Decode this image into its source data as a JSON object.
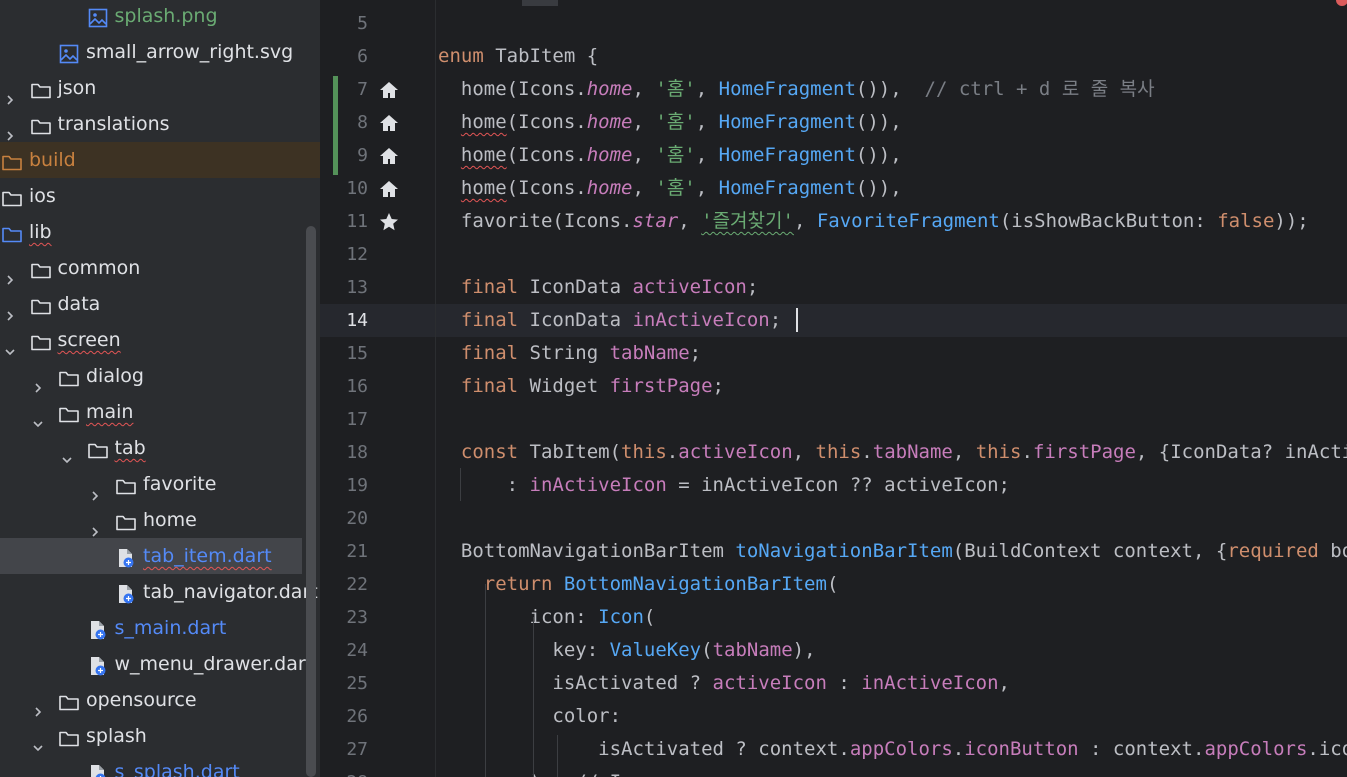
{
  "project_tree": {
    "items": [
      {
        "label": "splash.png",
        "kind": "image",
        "indent": 3,
        "expander": "none",
        "color": "green"
      },
      {
        "label": "small_arrow_right.svg",
        "kind": "image",
        "indent": 2,
        "expander": "none",
        "color": "normal"
      },
      {
        "label": "json",
        "kind": "folder",
        "indent": 1,
        "expander": "collapsed",
        "color": "normal"
      },
      {
        "label": "translations",
        "kind": "folder",
        "indent": 1,
        "expander": "collapsed",
        "color": "normal"
      },
      {
        "label": "build",
        "kind": "folder-excluded",
        "indent": 0,
        "expander": "none",
        "color": "orange"
      },
      {
        "label": "ios",
        "kind": "folder",
        "indent": 0,
        "expander": "none",
        "color": "normal"
      },
      {
        "label": "lib",
        "kind": "folder-source",
        "indent": 0,
        "expander": "none",
        "color": "normal",
        "squiggle": true
      },
      {
        "label": "common",
        "kind": "folder",
        "indent": 1,
        "expander": "collapsed",
        "color": "normal"
      },
      {
        "label": "data",
        "kind": "folder",
        "indent": 1,
        "expander": "collapsed",
        "color": "normal"
      },
      {
        "label": "screen",
        "kind": "folder",
        "indent": 1,
        "expander": "expanded",
        "color": "normal",
        "squiggle": true
      },
      {
        "label": "dialog",
        "kind": "folder",
        "indent": 2,
        "expander": "collapsed",
        "color": "normal"
      },
      {
        "label": "main",
        "kind": "folder",
        "indent": 2,
        "expander": "expanded",
        "color": "normal",
        "squiggle": true
      },
      {
        "label": "tab",
        "kind": "folder",
        "indent": 3,
        "expander": "expanded",
        "color": "normal",
        "squiggle": true
      },
      {
        "label": "favorite",
        "kind": "folder",
        "indent": 4,
        "expander": "collapsed",
        "color": "normal"
      },
      {
        "label": "home",
        "kind": "folder",
        "indent": 4,
        "expander": "collapsed",
        "color": "normal"
      },
      {
        "label": "tab_item.dart",
        "kind": "dart",
        "indent": 4,
        "expander": "none",
        "color": "blue",
        "selected": true,
        "squiggle": true
      },
      {
        "label": "tab_navigator.dart",
        "kind": "dart",
        "indent": 4,
        "expander": "none",
        "color": "normal"
      },
      {
        "label": "s_main.dart",
        "kind": "dart",
        "indent": 3,
        "expander": "none",
        "color": "blue"
      },
      {
        "label": "w_menu_drawer.dart",
        "kind": "dart",
        "indent": 3,
        "expander": "none",
        "color": "normal"
      },
      {
        "label": "opensource",
        "kind": "folder",
        "indent": 2,
        "expander": "collapsed",
        "color": "normal"
      },
      {
        "label": "splash",
        "kind": "folder",
        "indent": 2,
        "expander": "expanded",
        "color": "normal"
      },
      {
        "label": "s_splash.dart",
        "kind": "dart",
        "indent": 3,
        "expander": "none",
        "color": "blue"
      }
    ]
  },
  "editor": {
    "current_line": "14",
    "lines": [
      {
        "n": "5",
        "gutter": "",
        "code": []
      },
      {
        "n": "6",
        "gutter": "",
        "code": [
          [
            "kw",
            "enum "
          ],
          [
            "",
            "TabItem {"
          ]
        ]
      },
      {
        "n": "7",
        "gutter": "home-icon",
        "code": [
          [
            "",
            "  home(Icons."
          ],
          [
            "fit",
            "home"
          ],
          [
            "",
            ", "
          ],
          [
            "str",
            "'홈'"
          ],
          [
            "",
            ", "
          ],
          [
            "cls",
            "HomeFragment"
          ],
          [
            "",
            "()),  "
          ],
          [
            "cmt",
            "// ctrl + d 로 줄 복사"
          ]
        ]
      },
      {
        "n": "8",
        "gutter": "home-icon",
        "code": [
          [
            "",
            "  "
          ],
          [
            "wavy",
            "home"
          ],
          [
            "",
            "(Icons."
          ],
          [
            "fit",
            "home"
          ],
          [
            "",
            ", "
          ],
          [
            "str",
            "'홈'"
          ],
          [
            "",
            ", "
          ],
          [
            "cls",
            "HomeFragment"
          ],
          [
            "",
            "()),"
          ]
        ]
      },
      {
        "n": "9",
        "gutter": "home-icon",
        "code": [
          [
            "",
            "  "
          ],
          [
            "wavy",
            "home"
          ],
          [
            "",
            "(Icons."
          ],
          [
            "fit",
            "home"
          ],
          [
            "",
            ", "
          ],
          [
            "str",
            "'홈'"
          ],
          [
            "",
            ", "
          ],
          [
            "cls",
            "HomeFragment"
          ],
          [
            "",
            "()),"
          ]
        ]
      },
      {
        "n": "10",
        "gutter": "home-icon",
        "code": [
          [
            "",
            "  "
          ],
          [
            "wavy",
            "home"
          ],
          [
            "",
            "(Icons."
          ],
          [
            "fit",
            "home"
          ],
          [
            "",
            ", "
          ],
          [
            "str",
            "'홈'"
          ],
          [
            "",
            ", "
          ],
          [
            "cls",
            "HomeFragment"
          ],
          [
            "",
            "()),"
          ]
        ]
      },
      {
        "n": "11",
        "gutter": "star-icon",
        "code": [
          [
            "",
            "  favorite(Icons."
          ],
          [
            "fit",
            "star"
          ],
          [
            "",
            ", "
          ],
          [
            "strw",
            "'즐겨찾기'"
          ],
          [
            "",
            ", "
          ],
          [
            "cls",
            "FavoriteFragment"
          ],
          [
            "",
            "(isShowBackButton: "
          ],
          [
            "kw",
            "false"
          ],
          [
            "",
            "));"
          ]
        ]
      },
      {
        "n": "12",
        "gutter": "",
        "code": []
      },
      {
        "n": "13",
        "gutter": "",
        "code": [
          [
            "kw",
            "  final "
          ],
          [
            "",
            "IconData "
          ],
          [
            "fld",
            "activeIcon"
          ],
          [
            "",
            ";"
          ]
        ]
      },
      {
        "n": "14",
        "gutter": "",
        "code": [
          [
            "kw",
            "  final "
          ],
          [
            "",
            "IconData "
          ],
          [
            "fld",
            "inActiveIcon"
          ],
          [
            "",
            ";"
          ]
        ]
      },
      {
        "n": "15",
        "gutter": "",
        "code": [
          [
            "kw",
            "  final "
          ],
          [
            "",
            "String "
          ],
          [
            "fld",
            "tabName"
          ],
          [
            "",
            ";"
          ]
        ]
      },
      {
        "n": "16",
        "gutter": "",
        "code": [
          [
            "kw",
            "  final "
          ],
          [
            "",
            "Widget "
          ],
          [
            "fld",
            "firstPage"
          ],
          [
            "",
            ";"
          ]
        ]
      },
      {
        "n": "17",
        "gutter": "",
        "code": []
      },
      {
        "n": "18",
        "gutter": "",
        "code": [
          [
            "kw",
            "  const "
          ],
          [
            "",
            "TabItem("
          ],
          [
            "kw",
            "this"
          ],
          [
            "",
            "."
          ],
          [
            "fld",
            "activeIcon"
          ],
          [
            "",
            ", "
          ],
          [
            "kw",
            "this"
          ],
          [
            "",
            "."
          ],
          [
            "fld",
            "tabName"
          ],
          [
            "",
            ", "
          ],
          [
            "kw",
            "this"
          ],
          [
            "",
            "."
          ],
          [
            "fld",
            "firstPage"
          ],
          [
            "",
            ", {IconData? inActiveIcon})"
          ]
        ]
      },
      {
        "n": "19",
        "gutter": "",
        "code": [
          [
            "",
            "      : "
          ],
          [
            "fld",
            "inActiveIcon"
          ],
          [
            "",
            " = inActiveIcon ?? activeIcon;"
          ]
        ]
      },
      {
        "n": "20",
        "gutter": "",
        "code": []
      },
      {
        "n": "21",
        "gutter": "",
        "code": [
          [
            "",
            "  BottomNavigationBarItem "
          ],
          [
            "fn",
            "toNavigationBarItem"
          ],
          [
            "",
            "(BuildContext context, {"
          ],
          [
            "kw",
            "required"
          ],
          [
            "",
            " bool isActivated}) {"
          ]
        ]
      },
      {
        "n": "22",
        "gutter": "",
        "code": [
          [
            "kw",
            "    return "
          ],
          [
            "cls",
            "BottomNavigationBarItem"
          ],
          [
            "",
            "("
          ]
        ]
      },
      {
        "n": "23",
        "gutter": "",
        "code": [
          [
            "",
            "        icon: "
          ],
          [
            "cls",
            "Icon"
          ],
          [
            "",
            "("
          ]
        ]
      },
      {
        "n": "24",
        "gutter": "",
        "code": [
          [
            "",
            "          key: "
          ],
          [
            "cls",
            "ValueKey"
          ],
          [
            "",
            "("
          ],
          [
            "fld",
            "tabName"
          ],
          [
            "",
            "),"
          ]
        ]
      },
      {
        "n": "25",
        "gutter": "",
        "code": [
          [
            "",
            "          isActivated ? "
          ],
          [
            "fld",
            "activeIcon"
          ],
          [
            "",
            " : "
          ],
          [
            "fld",
            "inActiveIcon"
          ],
          [
            "",
            ","
          ]
        ]
      },
      {
        "n": "26",
        "gutter": "",
        "code": [
          [
            "",
            "          color:"
          ]
        ]
      },
      {
        "n": "27",
        "gutter": "",
        "code": [
          [
            "",
            "              isActivated ? context."
          ],
          [
            "fld",
            "appColors"
          ],
          [
            "",
            "."
          ],
          [
            "fld",
            "iconButton"
          ],
          [
            "",
            " : context."
          ],
          [
            "fld",
            "appColors"
          ],
          [
            "",
            ".iconButtonInactivate,"
          ]
        ]
      },
      {
        "n": "28",
        "gutter": "",
        "code": [
          [
            "",
            "        ),  // I"
          ]
        ]
      }
    ]
  },
  "colors": {
    "tree_bg": "#2b2d30",
    "editor_bg": "#1e1f22",
    "folder_stroke": "#dfe1e5",
    "source_folder": "#548af7",
    "excluded_orange": "#c8813f",
    "file_blue": "#548af7",
    "file_green": "#6aab73",
    "vcs_added": "#549159"
  }
}
